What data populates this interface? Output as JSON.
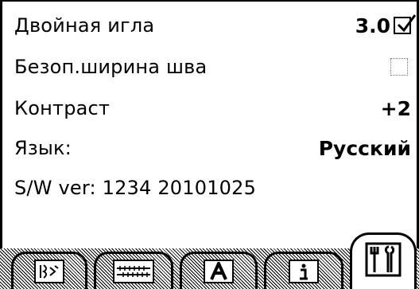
{
  "settings": [
    {
      "label": "Двойная игла",
      "value": "3.0",
      "control": "checkbox-checked"
    },
    {
      "label": "Безоп.ширина шва",
      "value": "",
      "control": "checkbox-empty"
    },
    {
      "label": "Контраст",
      "value": "+2"
    },
    {
      "label": "Язык:",
      "value": "Русский"
    },
    {
      "label": "S/W ver: 1234 20101025",
      "value": ""
    }
  ],
  "tabs": [
    {
      "icon": "stitch-settings-icon",
      "active": false
    },
    {
      "icon": "ruler-settings-icon",
      "active": false
    },
    {
      "icon": "font-settings-icon",
      "active": false
    },
    {
      "icon": "info-icon",
      "active": false
    },
    {
      "icon": "tools-icon",
      "active": true
    }
  ]
}
